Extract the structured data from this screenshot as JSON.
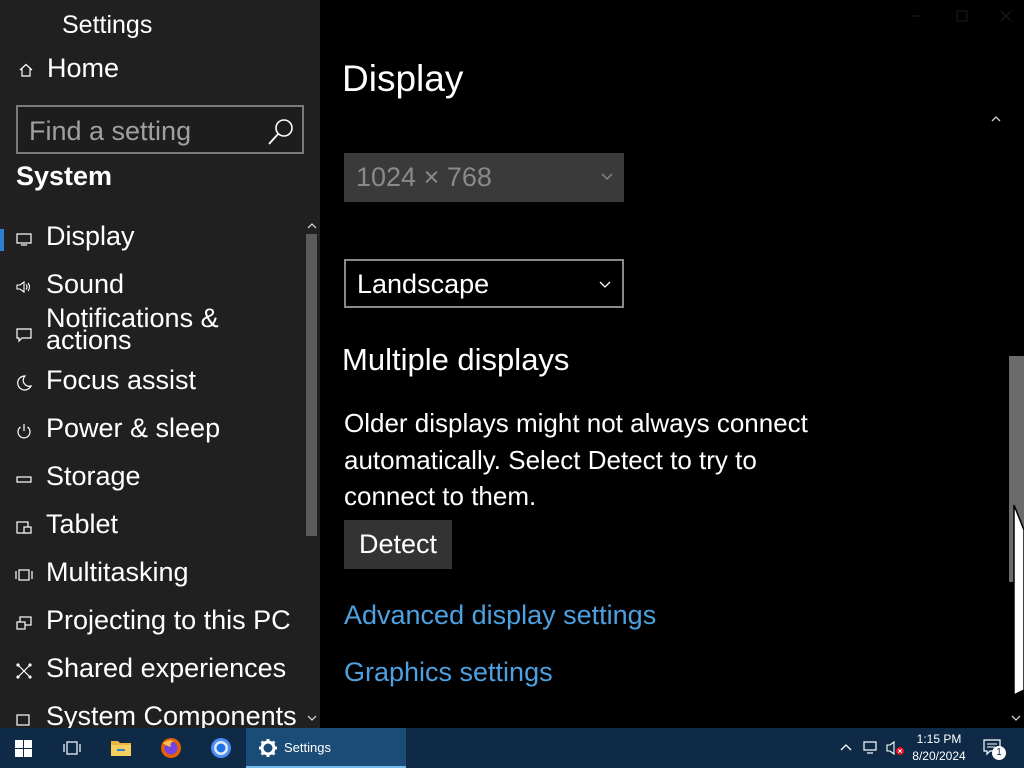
{
  "app": {
    "title": "Settings"
  },
  "sidebar": {
    "home_label": "Home",
    "search_placeholder": "Find a setting",
    "section_title": "System",
    "items": [
      {
        "label": "Display",
        "icon": "display-icon",
        "selected": true
      },
      {
        "label": "Sound",
        "icon": "sound-icon"
      },
      {
        "label": "Notifications & actions",
        "icon": "notifications-icon"
      },
      {
        "label": "Focus assist",
        "icon": "moon-icon"
      },
      {
        "label": "Power & sleep",
        "icon": "power-icon"
      },
      {
        "label": "Storage",
        "icon": "storage-icon"
      },
      {
        "label": "Tablet",
        "icon": "tablet-icon"
      },
      {
        "label": "Multitasking",
        "icon": "multitasking-icon"
      },
      {
        "label": "Projecting to this PC",
        "icon": "projecting-icon"
      },
      {
        "label": "Shared experiences",
        "icon": "shared-experiences-icon"
      },
      {
        "label": "System Components",
        "icon": "system-components-icon"
      }
    ]
  },
  "main": {
    "title": "Display",
    "resolution_value": "1024 × 768",
    "orientation_value": "Landscape",
    "multiple_displays_title": "Multiple displays",
    "multiple_displays_desc": "Older displays might not always connect automatically. Select Detect to try to connect to them.",
    "detect_label": "Detect",
    "advanced_link": "Advanced display settings",
    "graphics_link": "Graphics settings"
  },
  "taskbar": {
    "apps": [
      {
        "name": "start",
        "icon": "windows-logo-icon"
      },
      {
        "name": "task-view",
        "icon": "task-view-icon"
      },
      {
        "name": "file-explorer",
        "icon": "folder-icon"
      },
      {
        "name": "firefox",
        "icon": "firefox-icon"
      },
      {
        "name": "chrome",
        "icon": "chrome-icon"
      }
    ],
    "active_app_label": "Settings",
    "time": "1:15 PM",
    "date": "8/20/2024",
    "notification_count": "1"
  },
  "colors": {
    "sidebar_bg": "#202020",
    "main_bg": "#000000",
    "accent": "#2e7dd1",
    "link": "#4ea1e0",
    "taskbar_bg": "#0e2a47"
  }
}
